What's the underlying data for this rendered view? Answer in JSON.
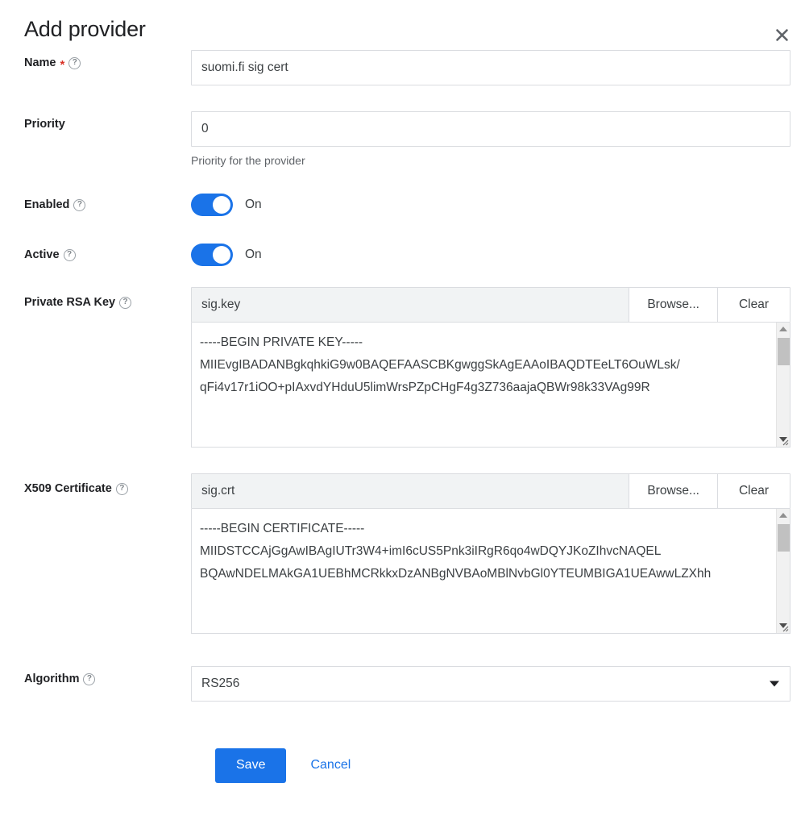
{
  "dialog": {
    "title": "Add provider",
    "close_icon": "close-icon"
  },
  "fields": {
    "name": {
      "label": "Name",
      "required_marker": "*",
      "help_icon": "question-mark-icon",
      "value": "suomi.fi sig cert"
    },
    "priority": {
      "label": "Priority",
      "value": "0",
      "helper_text": "Priority for the provider"
    },
    "enabled": {
      "label": "Enabled",
      "help_icon": "question-mark-icon",
      "state_label": "On",
      "checked": true
    },
    "active": {
      "label": "Active",
      "help_icon": "question-mark-icon",
      "state_label": "On",
      "checked": true
    },
    "private_rsa_key": {
      "label": "Private RSA Key",
      "help_icon": "question-mark-icon",
      "file_name": "sig.key",
      "browse_label": "Browse...",
      "clear_label": "Clear",
      "content": "-----BEGIN PRIVATE KEY-----\nMIIEvgIBADANBgkqhkiG9w0BAQEFAASCBKgwggSkAgEAAoIBAQDTEeLT6OuWLsk/\nqFi4v17r1iOO+pIAxvdYHduU5limWrsPZpCHgF4g3Z736aajaQBWr98k33VAg99R"
    },
    "x509_certificate": {
      "label": "X509 Certificate",
      "help_icon": "question-mark-icon",
      "file_name": "sig.crt",
      "browse_label": "Browse...",
      "clear_label": "Clear",
      "content": "-----BEGIN CERTIFICATE-----\nMIIDSTCCAjGgAwIBAgIUTr3W4+imI6cUS5Pnk3iIRgR6qo4wDQYJKoZIhvcNAQEL\nBQAwNDELMAkGA1UEBhMCRkkxDzANBgNVBAoMBlNvbGl0YTEUMBIGA1UEAwwLZXhh"
    },
    "algorithm": {
      "label": "Algorithm",
      "help_icon": "question-mark-icon",
      "selected": "RS256",
      "caret_icon": "chevron-down-icon"
    }
  },
  "actions": {
    "save_label": "Save",
    "cancel_label": "Cancel"
  },
  "colors": {
    "accent": "#1a73e8",
    "required": "#d93025",
    "border": "#dadce0",
    "file_bg": "#f1f3f4"
  }
}
